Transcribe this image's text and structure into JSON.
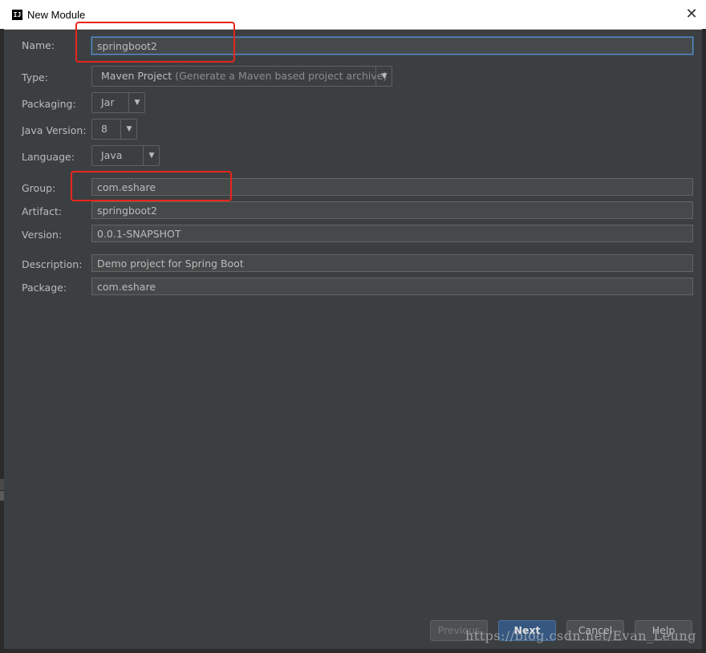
{
  "window": {
    "title": "New Module",
    "app_icon_text": "IJ",
    "close_glyph": "✕"
  },
  "form": {
    "name": {
      "label": "Name:",
      "value": "springboot2"
    },
    "type": {
      "label": "Type:",
      "value": "Maven Project",
      "hint": "(Generate a Maven based project archive)"
    },
    "packaging": {
      "label": "Packaging:",
      "value": "Jar"
    },
    "java_version": {
      "label": "Java Version:",
      "value": "8"
    },
    "language": {
      "label": "Language:",
      "value": "Java"
    },
    "group": {
      "label": "Group:",
      "value": "com.eshare"
    },
    "artifact": {
      "label": "Artifact:",
      "value": "springboot2"
    },
    "version": {
      "label": "Version:",
      "value": "0.0.1-SNAPSHOT"
    },
    "description": {
      "label": "Description:",
      "value": "Demo project for Spring Boot"
    },
    "package": {
      "label": "Package:",
      "value": "com.eshare"
    }
  },
  "buttons": {
    "previous": "Previous",
    "next": "Next",
    "cancel": "Cancel",
    "help": "Help"
  },
  "icons": {
    "dropdown": "chevron-down-icon",
    "dropdown_glyph": "▼"
  },
  "watermark": "https://blog.csdn.net/Evan_Leung",
  "colors": {
    "background": "#3c3f41",
    "highlight": "#e8261c",
    "primary_button": "#365880"
  }
}
